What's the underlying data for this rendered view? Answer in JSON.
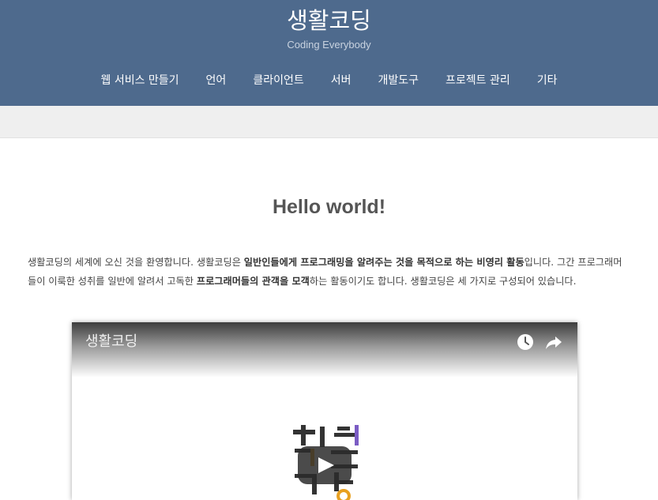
{
  "header": {
    "title": "생활코딩",
    "subtitle": "Coding Everybody",
    "background": "#4e6a8d"
  },
  "nav": {
    "items": [
      {
        "label": "웹 서비스 만들기"
      },
      {
        "label": "언어"
      },
      {
        "label": "클라이언트"
      },
      {
        "label": "서버"
      },
      {
        "label": "개발도구"
      },
      {
        "label": "프로젝트 관리"
      },
      {
        "label": "기타"
      }
    ]
  },
  "article": {
    "title": "Hello world!",
    "body": {
      "part1": "생활코딩의 세계에 오신 것을 환영합니다. 생활코딩은 ",
      "bold1": "일반인들에게 프로그래밍을 알려주는 것을 목적으로 하는 비영리 활동",
      "part2": "입니다. 그간 프로그래머들이 이룩한 성취를 일반에 알려서 고독한 ",
      "bold2": "프로그래머들의 관객을 모객",
      "part3": "하는 활동이기도 합니다. 생활코딩은 세 가지로 구성되어 있습니다."
    }
  },
  "video": {
    "title": "생활코딩",
    "watch_later_icon": "clock-icon",
    "share_icon": "share-arrow-icon",
    "play_icon": "play-icon"
  },
  "colors": {
    "header_bg": "#4e6a8d",
    "subbar_bg": "#efefef",
    "title_text": "#555555"
  }
}
